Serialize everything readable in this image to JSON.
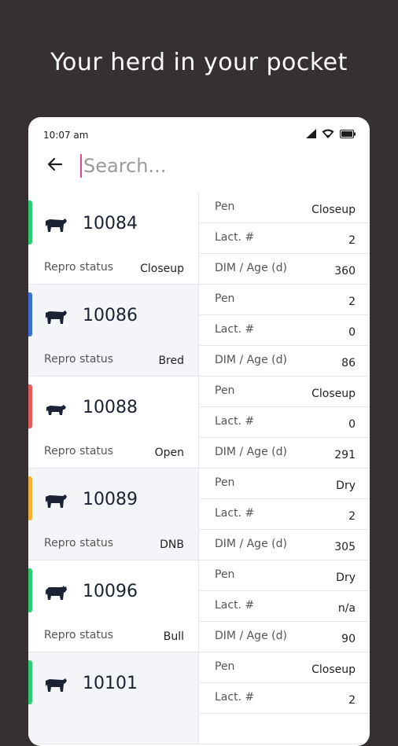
{
  "headline": "Your herd in your pocket",
  "status_bar": {
    "time": "10:07 am",
    "icons": [
      "signal-icon",
      "wifi-icon",
      "battery-icon"
    ]
  },
  "search": {
    "placeholder": "Search...",
    "value": ""
  },
  "labels": {
    "repro": "Repro status",
    "pen": "Pen",
    "lact": "Lact. #",
    "dim": "DIM / Age (d)"
  },
  "colors": {
    "green": "#2ecc71",
    "blue": "#3a6fd8",
    "red": "#e45b5b",
    "orange": "#f2b23a",
    "navy": "#1b2233",
    "background": "#363033"
  },
  "animals": [
    {
      "id": "10084",
      "icon": "cow-icon",
      "accent": "#2ecc71",
      "repro": "Closeup",
      "pen": "Closeup",
      "lact": "2",
      "dim": "360"
    },
    {
      "id": "10086",
      "icon": "cow-icon",
      "accent": "#3a6fd8",
      "repro": "Bred",
      "pen": "2",
      "lact": "0",
      "dim": "86"
    },
    {
      "id": "10088",
      "icon": "calf-icon",
      "accent": "#e45b5b",
      "repro": "Open",
      "pen": "Closeup",
      "lact": "0",
      "dim": "291"
    },
    {
      "id": "10089",
      "icon": "cow-icon",
      "accent": "#f2b23a",
      "repro": "DNB",
      "pen": "Dry",
      "lact": "2",
      "dim": "305"
    },
    {
      "id": "10096",
      "icon": "bull-icon",
      "accent": "#2ecc71",
      "repro": "Bull",
      "pen": "Dry",
      "lact": "n/a",
      "dim": "90"
    },
    {
      "id": "10101",
      "icon": "cow-icon",
      "accent": "#2ecc71",
      "repro": "",
      "pen": "Closeup",
      "lact": "2",
      "dim": ""
    }
  ]
}
